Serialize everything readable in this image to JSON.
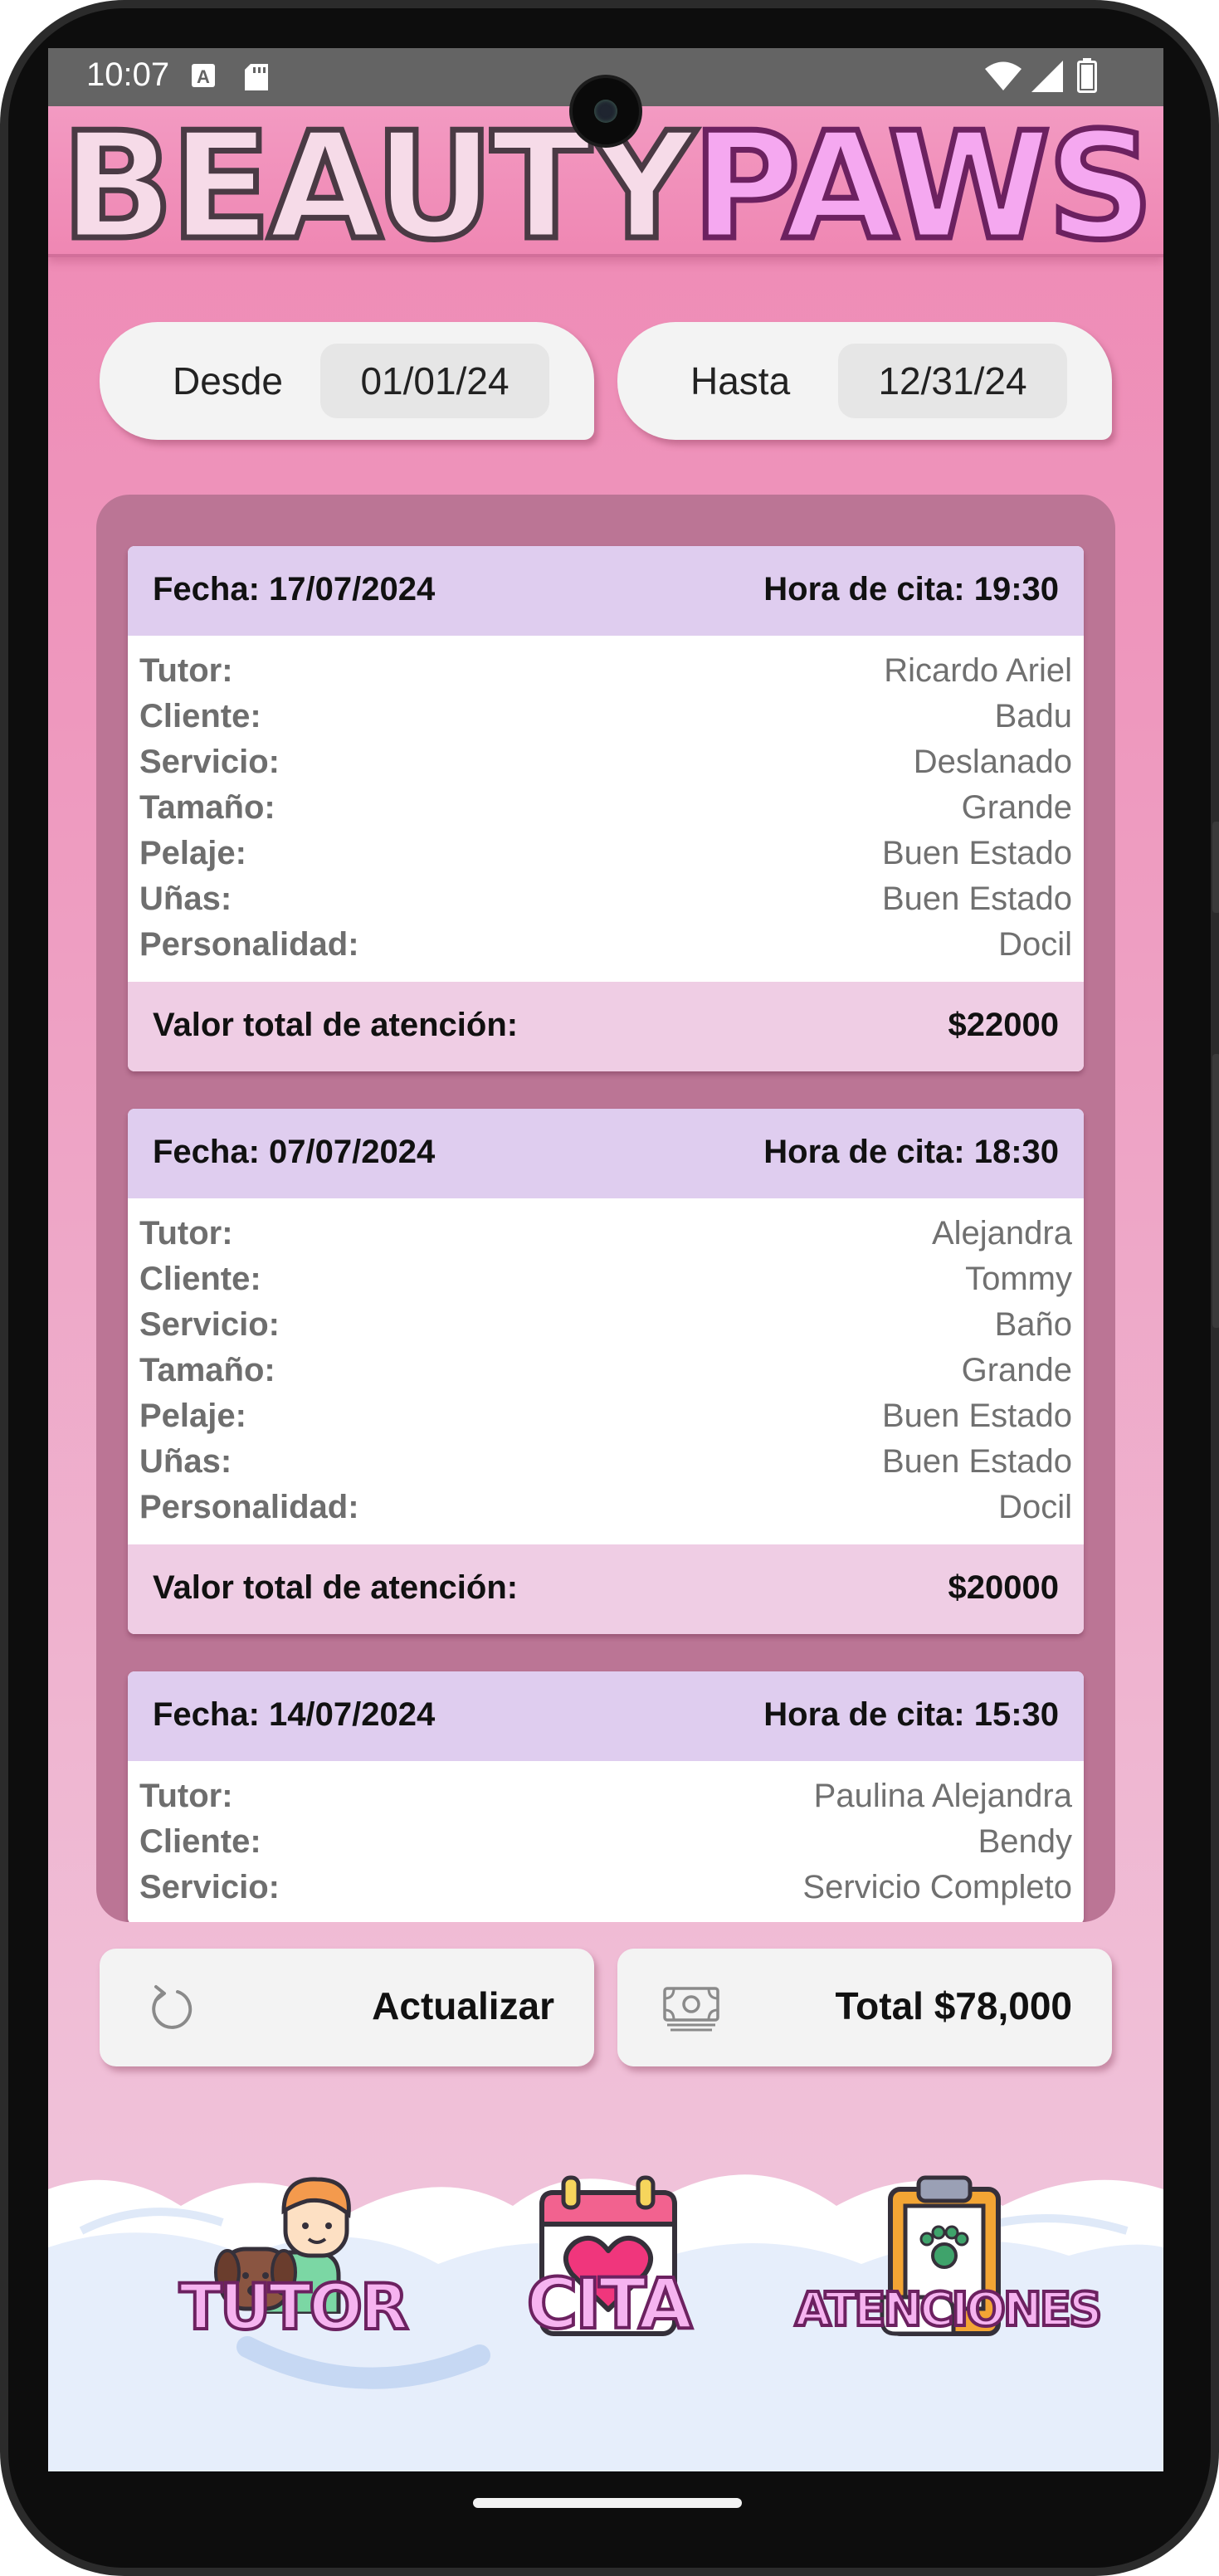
{
  "status_bar": {
    "time": "10:07"
  },
  "header": {
    "logo_part1": "BEAUTY",
    "logo_part2": "PAWS"
  },
  "filters": {
    "from_label": "Desde",
    "from_value": "01/01/24",
    "to_label": "Hasta",
    "to_value": "12/31/24"
  },
  "labels": {
    "fecha": "Fecha:",
    "hora": "Hora de cita:",
    "tutor": "Tutor:",
    "cliente": "Cliente:",
    "servicio": "Servicio:",
    "tamano": "Tamaño:",
    "pelaje": "Pelaje:",
    "unas": "Uñas:",
    "personalidad": "Personalidad:",
    "total": "Valor total de atención:"
  },
  "appointments": [
    {
      "fecha": "Fecha: 17/07/2024",
      "hora": "Hora de cita: 19:30",
      "tutor": "Ricardo Ariel",
      "cliente": "Badu",
      "servicio": "Deslanado",
      "tamano": "Grande",
      "pelaje": "Buen Estado",
      "unas": "Buen Estado",
      "personalidad": "Docil",
      "total": "$22000"
    },
    {
      "fecha": "Fecha: 07/07/2024",
      "hora": "Hora de cita: 18:30",
      "tutor": "Alejandra",
      "cliente": "Tommy",
      "servicio": "Baño",
      "tamano": "Grande",
      "pelaje": "Buen Estado",
      "unas": "Buen Estado",
      "personalidad": "Docil",
      "total": "$20000"
    },
    {
      "fecha": "Fecha: 14/07/2024",
      "hora": "Hora de cita: 15:30",
      "tutor": "Paulina Alejandra",
      "cliente": "Bendy",
      "servicio": "Servicio Completo"
    }
  ],
  "actions": {
    "refresh_label": "Actualizar",
    "total_label": "Total $78,000"
  },
  "bottom_nav": {
    "tutor": "TUTOR",
    "cita": "CITA",
    "atenciones": "ATENCIONES"
  },
  "icons": {
    "refresh": "refresh-icon",
    "money": "money-icon",
    "tutor": "tutor-with-dog-icon",
    "cita": "calendar-heart-icon",
    "atenciones": "clipboard-paw-icon"
  },
  "colors": {
    "accent_pink": "#ef87b3",
    "card_header": "#dfcdef",
    "card_footer": "#efcde4",
    "list_bg": "#bb7595",
    "logo_light": "#f6dbe8",
    "logo_pink": "#f5a8f0"
  }
}
